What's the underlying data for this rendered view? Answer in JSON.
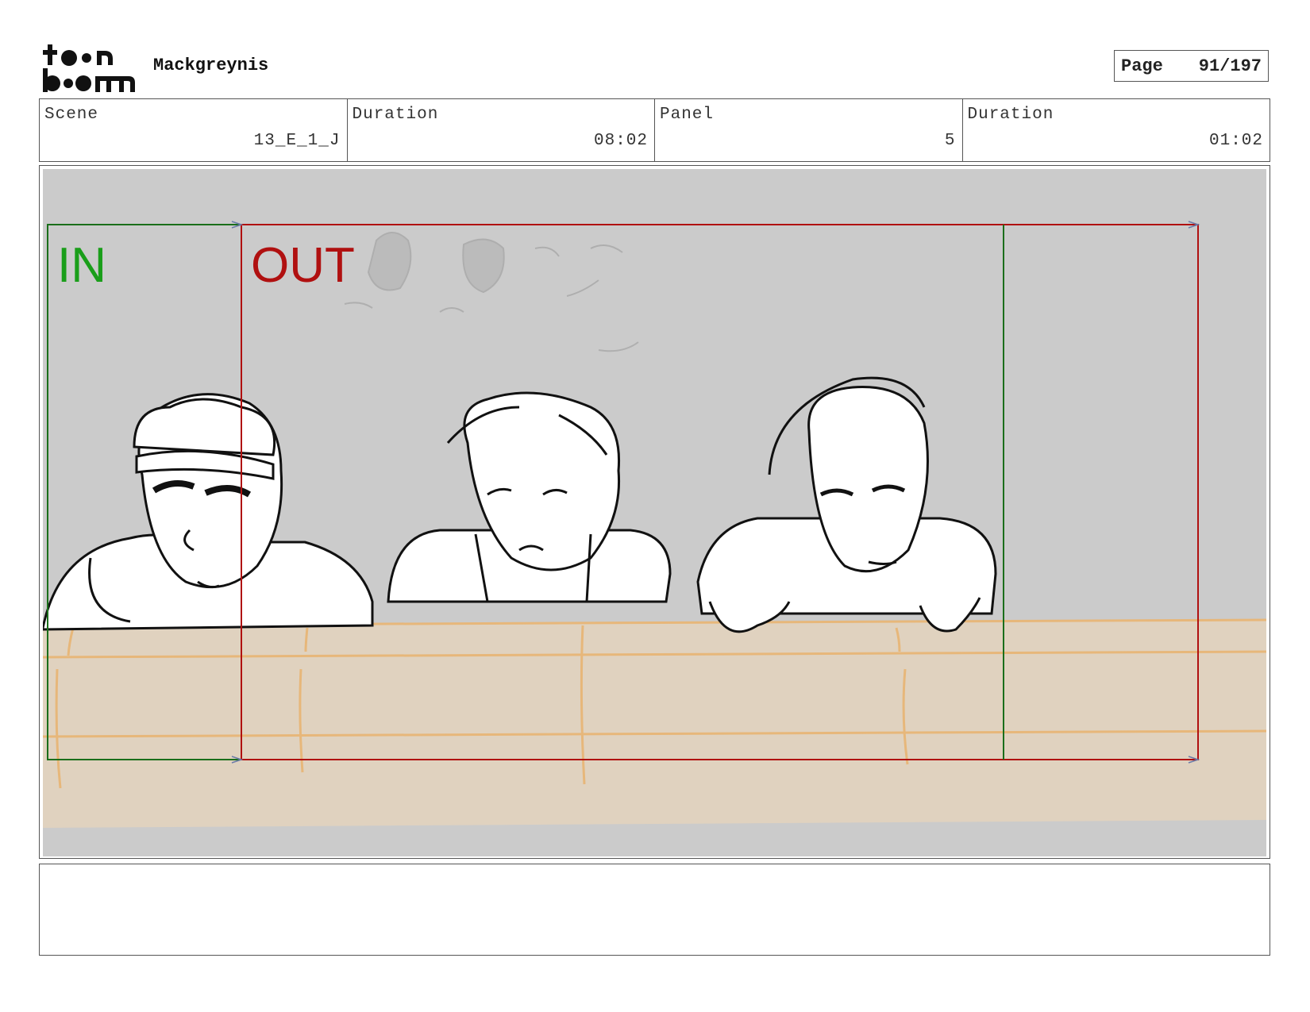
{
  "header": {
    "logo_icon": "toon-boom-logo",
    "logo_text_top": "toon",
    "logo_text_bottom": "boom",
    "project_title": "Mackgreynis",
    "page_label": "Page",
    "page_number": "91/197"
  },
  "info": {
    "scene_label": "Scene",
    "scene_value": "13_E_1_J",
    "duration_label": "Duration",
    "duration_value": "08:02",
    "panel_label": "Panel",
    "panel_value": "5",
    "panel_duration_label": "Duration",
    "panel_duration_value": "01:02"
  },
  "panel": {
    "in_label": "IN",
    "out_label": "OUT",
    "in_color": "#1a9e1a",
    "out_color": "#b01010",
    "background_color": "#cbcbcb",
    "wall_color": "#e0d2bf"
  },
  "caption": {
    "text": ""
  }
}
